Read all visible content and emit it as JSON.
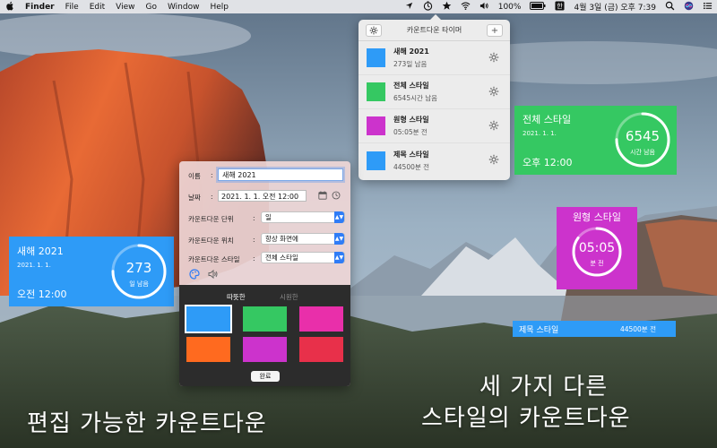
{
  "menubar": {
    "apple": "",
    "items": [
      "Finder",
      "File",
      "Edit",
      "View",
      "Go",
      "Window",
      "Help"
    ],
    "status": {
      "battery": "100%",
      "clock": "4월 3일 (금) 오후 7:39"
    }
  },
  "popover": {
    "title": "카운트다운 타이머",
    "add_label": "+",
    "items": [
      {
        "name": "새해 2021",
        "sub": "273일 남음",
        "color": "#2e9bf7"
      },
      {
        "name": "전체 스타일",
        "sub": "6545시간 남음",
        "color": "#35c862"
      },
      {
        "name": "원형 스타일",
        "sub": "05:05분 전",
        "color": "#cc33cc"
      },
      {
        "name": "제목 스타일",
        "sub": "44500분 전",
        "color": "#2e9bf7"
      }
    ]
  },
  "widget_left": {
    "name": "새해 2021",
    "date": "2021. 1. 1.",
    "time": "오전 12:00",
    "number": "273",
    "unit": "일 남음",
    "color": "#2e9bf7",
    "progress": 0.75
  },
  "widget_green": {
    "name": "전체 스타일",
    "date": "2021. 1. 1.",
    "time": "오후 12:00",
    "number": "6545",
    "unit": "시간 남음",
    "color": "#35c862",
    "progress": 0.75
  },
  "widget_circle": {
    "name": "원형 스타일",
    "number": "05:05",
    "unit": "분 전",
    "color": "#cc33cc",
    "progress": 0.85
  },
  "widget_title": {
    "name": "제목 스타일",
    "value": "44500분 전",
    "color": "#2e9bf7"
  },
  "editor": {
    "name_label": "이름",
    "name_value": "새해 2021",
    "date_label": "날짜",
    "date_value": "2021.   1.   1. 오전 12:00",
    "unit_label": "카운트다운 단위",
    "unit_value": "일",
    "position_label": "카운트다운 위치",
    "position_value": "항상 화면에",
    "style_label": "카운트다운 스타일",
    "style_value": "전체 스타일",
    "colon": ":",
    "tab_warm": "따뜻한",
    "tab_cool": "시원한",
    "done": "완료",
    "swatches": [
      "#2e9bf7",
      "#35c862",
      "#e92faa",
      "#ff6a1f",
      "#cc33cc",
      "#e8304a"
    ]
  },
  "captions": {
    "left": "편집 가능한 카운트다운",
    "right_line1": "세 가지 다른",
    "right_line2": "스타일의 카운트다운"
  }
}
